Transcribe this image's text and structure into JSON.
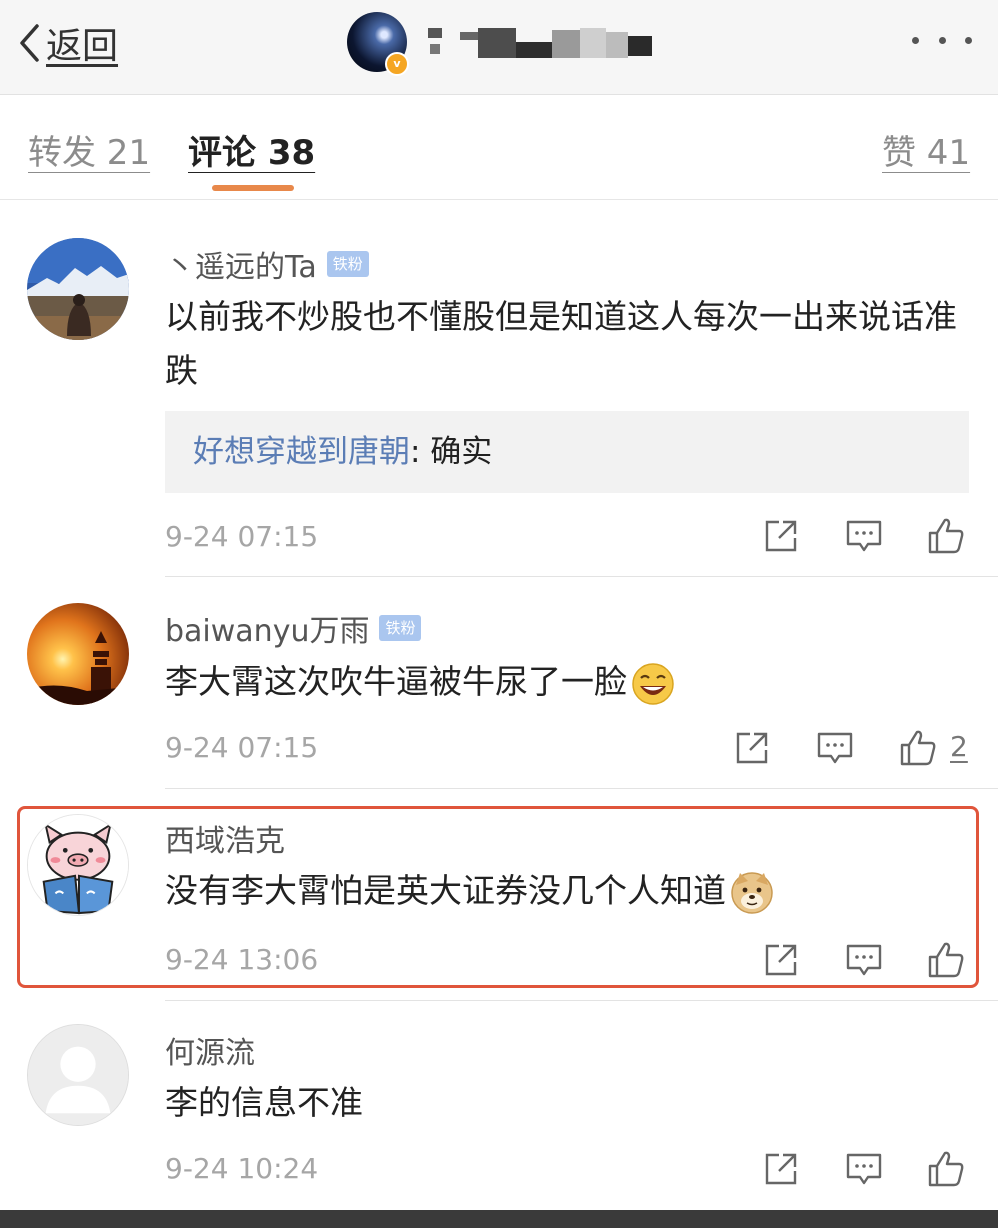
{
  "header": {
    "back_label": "返回"
  },
  "tabs": {
    "repost": "转发 21",
    "comment": "评论 38",
    "like": "赞 41"
  },
  "comments": [
    {
      "name": "丶遥远的Ta",
      "badge": "铁粉",
      "text": "以前我不炒股也不懂股但是知道这人每次一出来说话准跌",
      "reply": {
        "name": "好想穿越到唐朝",
        "text": ": 确实"
      },
      "time": "9-24 07:15"
    },
    {
      "name": "baiwanyu万雨",
      "badge": "铁粉",
      "text": "李大霄这次吹牛逼被牛尿了一脸",
      "emoji": "laughing-emoji",
      "time": "9-24 07:15",
      "likes": "2"
    },
    {
      "name": "西域浩克",
      "text": "没有李大霄怕是英大证券没几个人知道",
      "emoji": "doge-emoji",
      "time": "9-24 13:06",
      "highlight_color": "#e0553b"
    },
    {
      "name": "何源流",
      "text": "李的信息不准",
      "time": "9-24 10:24"
    }
  ]
}
